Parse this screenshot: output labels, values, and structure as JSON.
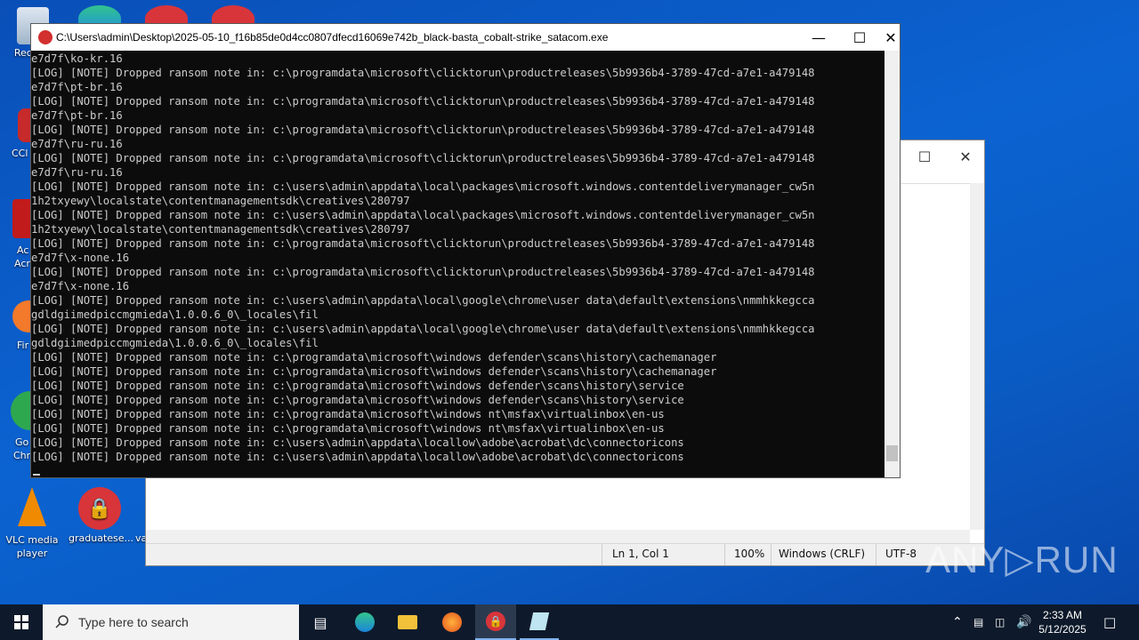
{
  "desktop": {
    "icons": [
      {
        "label": "Recycle"
      },
      {
        "label": "VLC media player"
      },
      {
        "label": "graduatese..."
      }
    ],
    "partial_labels": [
      "CCl",
      "Ac",
      "Acr",
      "Fir",
      "Go",
      "Chr",
      "va"
    ]
  },
  "notepad": {
    "status": {
      "position": "Ln 1, Col 1",
      "zoom": "100%",
      "line_ending": "Windows (CRLF)",
      "encoding": "UTF-8"
    }
  },
  "console": {
    "title": "C:\\Users\\admin\\Desktop\\2025-05-10_f16b85de0d4cc0807dfecd16069e742b_black-basta_cobalt-strike_satacom.exe",
    "lines": [
      "e7d7f\\ko-kr.16",
      "[LOG] [NOTE] Dropped ransom note in: c:\\programdata\\microsoft\\clicktorun\\productreleases\\5b9936b4-3789-47cd-a7e1-a479148",
      "e7d7f\\pt-br.16",
      "[LOG] [NOTE] Dropped ransom note in: c:\\programdata\\microsoft\\clicktorun\\productreleases\\5b9936b4-3789-47cd-a7e1-a479148",
      "e7d7f\\pt-br.16",
      "[LOG] [NOTE] Dropped ransom note in: c:\\programdata\\microsoft\\clicktorun\\productreleases\\5b9936b4-3789-47cd-a7e1-a479148",
      "e7d7f\\ru-ru.16",
      "[LOG] [NOTE] Dropped ransom note in: c:\\programdata\\microsoft\\clicktorun\\productreleases\\5b9936b4-3789-47cd-a7e1-a479148",
      "e7d7f\\ru-ru.16",
      "[LOG] [NOTE] Dropped ransom note in: c:\\users\\admin\\appdata\\local\\packages\\microsoft.windows.contentdeliverymanager_cw5n",
      "1h2txyewy\\localstate\\contentmanagementsdk\\creatives\\280797",
      "[LOG] [NOTE] Dropped ransom note in: c:\\users\\admin\\appdata\\local\\packages\\microsoft.windows.contentdeliverymanager_cw5n",
      "1h2txyewy\\localstate\\contentmanagementsdk\\creatives\\280797",
      "[LOG] [NOTE] Dropped ransom note in: c:\\programdata\\microsoft\\clicktorun\\productreleases\\5b9936b4-3789-47cd-a7e1-a479148",
      "e7d7f\\x-none.16",
      "[LOG] [NOTE] Dropped ransom note in: c:\\programdata\\microsoft\\clicktorun\\productreleases\\5b9936b4-3789-47cd-a7e1-a479148",
      "e7d7f\\x-none.16",
      "[LOG] [NOTE] Dropped ransom note in: c:\\users\\admin\\appdata\\local\\google\\chrome\\user data\\default\\extensions\\nmmhkkegcca",
      "gdldgiimedpiccmgmieda\\1.0.0.6_0\\_locales\\fil",
      "[LOG] [NOTE] Dropped ransom note in: c:\\users\\admin\\appdata\\local\\google\\chrome\\user data\\default\\extensions\\nmmhkkegcca",
      "gdldgiimedpiccmgmieda\\1.0.0.6_0\\_locales\\fil",
      "[LOG] [NOTE] Dropped ransom note in: c:\\programdata\\microsoft\\windows defender\\scans\\history\\cachemanager",
      "[LOG] [NOTE] Dropped ransom note in: c:\\programdata\\microsoft\\windows defender\\scans\\history\\cachemanager",
      "[LOG] [NOTE] Dropped ransom note in: c:\\programdata\\microsoft\\windows defender\\scans\\history\\service",
      "[LOG] [NOTE] Dropped ransom note in: c:\\programdata\\microsoft\\windows defender\\scans\\history\\service",
      "[LOG] [NOTE] Dropped ransom note in: c:\\programdata\\microsoft\\windows nt\\msfax\\virtualinbox\\en-us",
      "[LOG] [NOTE] Dropped ransom note in: c:\\programdata\\microsoft\\windows nt\\msfax\\virtualinbox\\en-us",
      "[LOG] [NOTE] Dropped ransom note in: c:\\users\\admin\\appdata\\locallow\\adobe\\acrobat\\dc\\connectoricons",
      "[LOG] [NOTE] Dropped ransom note in: c:\\users\\admin\\appdata\\locallow\\adobe\\acrobat\\dc\\connectoricons"
    ],
    "buttons": {
      "minimize": "—",
      "maximize": "☐",
      "close": "✕"
    }
  },
  "watermark": "ANY▷RUN",
  "taskbar": {
    "search_placeholder": "Type here to search",
    "clock_time": "2:33 AM",
    "clock_date": "5/12/2025"
  }
}
